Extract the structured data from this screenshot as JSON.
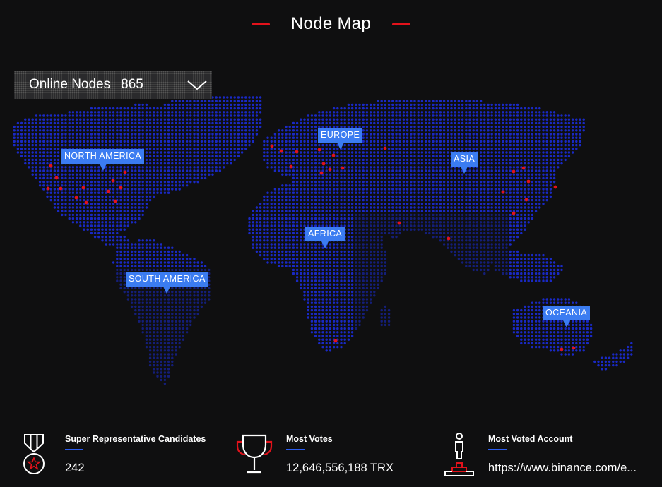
{
  "header": {
    "title": "Node Map",
    "accent_color": "#e3121b"
  },
  "node_filter": {
    "label": "Online Nodes",
    "count": "865",
    "icon": "chevron-down-icon"
  },
  "map": {
    "dot_color": "#1a2bd0",
    "node_color": "#e3121b",
    "regions": [
      {
        "label": "NORTH AMERICA"
      },
      {
        "label": "EUROPE"
      },
      {
        "label": "ASIA"
      },
      {
        "label": "AFRICA"
      },
      {
        "label": "SOUTH AMERICA"
      },
      {
        "label": "OCEANIA"
      }
    ]
  },
  "stats": [
    {
      "icon": "medal-icon",
      "label": "Super Representative Candidates",
      "value": "242"
    },
    {
      "icon": "trophy-icon",
      "label": "Most Votes",
      "value": "12,646,556,188 TRX"
    },
    {
      "icon": "podium-person-icon",
      "label": "Most Voted Account",
      "value": "https://www.binance.com/e..."
    }
  ],
  "colors": {
    "background": "#0f0f10",
    "region_label_bg": "#3b7cf1",
    "stat_underline": "#2b5df0"
  }
}
